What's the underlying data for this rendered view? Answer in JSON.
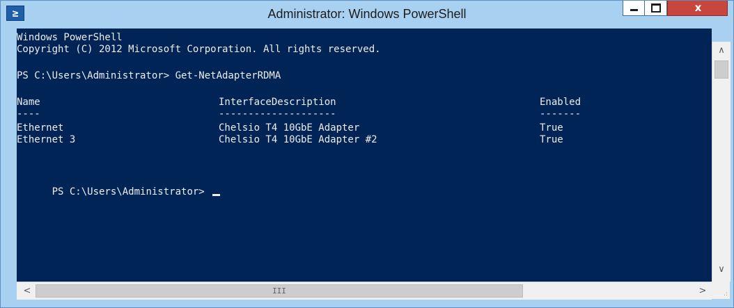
{
  "window": {
    "title": "Administrator: Windows PowerShell",
    "icon_glyph": "≥",
    "icon_name": "powershell-icon",
    "controls": {
      "minimize": "minimize-icon",
      "maximize": "maximize-icon",
      "close_glyph": "x"
    },
    "colors": {
      "frame": "#a8d0f0",
      "console_bg": "#012456",
      "console_fg": "#eeedf0",
      "close_bg": "#c7463d"
    }
  },
  "console": {
    "banner_line1": "Windows PowerShell",
    "banner_line2": "Copyright (C) 2012 Microsoft Corporation. All rights reserved.",
    "prompt1": "PS C:\\Users\\Administrator> Get-NetAdapterRDMA",
    "table": {
      "headers": [
        "Name",
        "InterfaceDescription",
        "Enabled"
      ],
      "separators": [
        "----",
        "--------------------",
        "-------"
      ],
      "rows": [
        [
          "Ethernet",
          "Chelsio T4 10GbE Adapter",
          "True"
        ],
        [
          "Ethernet 3",
          "Chelsio T4 10GbE Adapter #2",
          "True"
        ]
      ]
    },
    "prompt2": "PS C:\\Users\\Administrator> "
  },
  "scrollbars": {
    "up_arrow": "∧",
    "down_arrow": "∨",
    "left_arrow": "<",
    "right_arrow": ">",
    "hthumb_grip": "III",
    "resize_grip": ".:"
  }
}
